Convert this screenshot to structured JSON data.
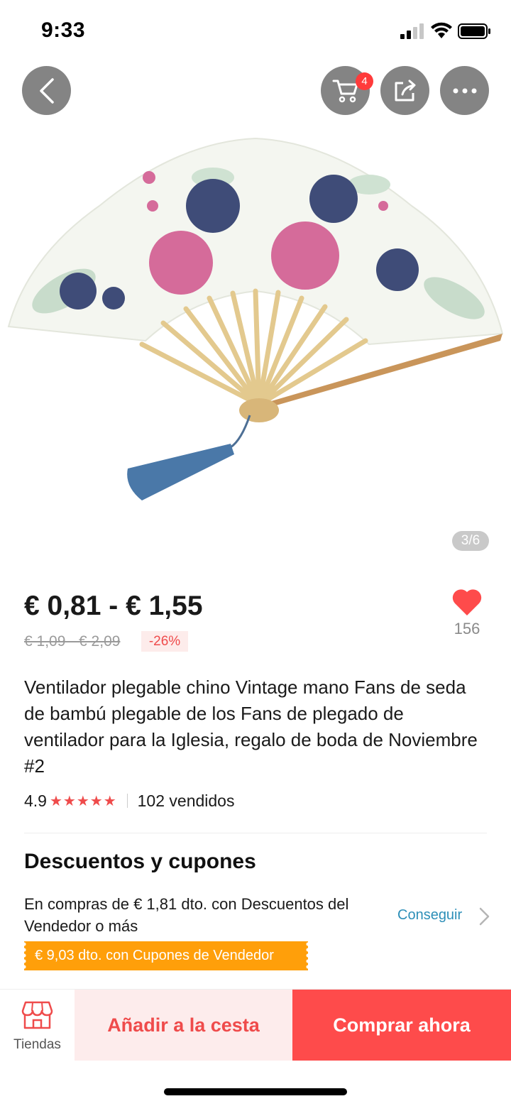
{
  "status_bar": {
    "time": "9:33"
  },
  "header": {
    "cart_count": "4"
  },
  "gallery": {
    "counter": "3/6"
  },
  "product": {
    "price": "€ 0,81 - € 1,55",
    "old_price": "€ 1,09 - € 2,09",
    "discount": "-26%",
    "wishlist_count": "156",
    "title": "Ventilador plegable chino Vintage mano Fans de seda de bambú plegable de los Fans de plegado de ventilador para la Iglesia, regalo de boda de Noviembre #2",
    "rating": "4.9",
    "stars": "★★★★★",
    "sold": "102 vendidos"
  },
  "promotions": {
    "title": "Descuentos y cupones",
    "description": "En compras de € 1,81 dto. con Descuentos del Vendedor o más",
    "get_label": "Conseguir",
    "coupon_label": "€ 9,03 dto. con Cupones de Vendedor"
  },
  "bottom_bar": {
    "stores_label": "Tiendas",
    "add_to_cart_label": "Añadir a la cesta",
    "buy_now_label": "Comprar ahora"
  },
  "colors": {
    "accent": "#fe4b4b",
    "link": "#2d8fb8",
    "coupon": "#ff9f0a",
    "add_cart_bg": "#fdecec"
  },
  "icons": [
    "back-arrow-icon",
    "cart-icon",
    "share-icon",
    "more-icon",
    "heart-icon",
    "chevron-right-icon",
    "store-icon"
  ]
}
